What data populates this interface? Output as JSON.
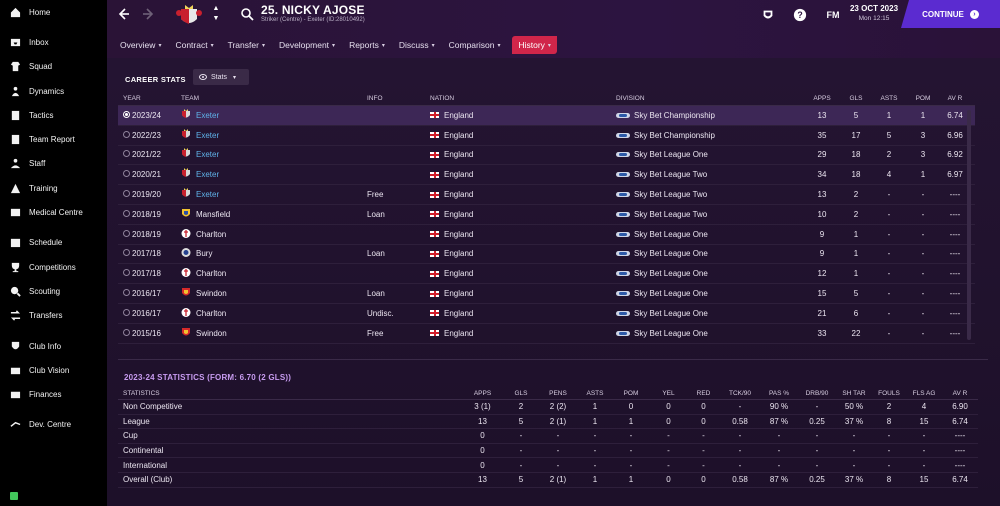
{
  "sidebar": {
    "items": [
      {
        "label": "Home",
        "icon": "home-icon"
      },
      {
        "label": "Inbox",
        "icon": "inbox-icon"
      },
      {
        "label": "Squad",
        "icon": "squad-icon"
      },
      {
        "label": "Dynamics",
        "icon": "dynamics-icon"
      },
      {
        "label": "Tactics",
        "icon": "tactics-icon"
      },
      {
        "label": "Team Report",
        "icon": "report-icon"
      },
      {
        "label": "Staff",
        "icon": "staff-icon"
      },
      {
        "label": "Training",
        "icon": "training-icon"
      },
      {
        "label": "Medical Centre",
        "icon": "medical-icon"
      },
      {
        "label": "Schedule",
        "icon": "calendar-icon"
      },
      {
        "label": "Competitions",
        "icon": "trophy-icon"
      },
      {
        "label": "Scouting",
        "icon": "scouting-icon"
      },
      {
        "label": "Transfers",
        "icon": "transfers-icon"
      },
      {
        "label": "Club Info",
        "icon": "shield-icon"
      },
      {
        "label": "Club Vision",
        "icon": "vision-icon"
      },
      {
        "label": "Finances",
        "icon": "finances-icon"
      },
      {
        "label": "Dev. Centre",
        "icon": "dev-centre-icon"
      }
    ]
  },
  "header": {
    "player_name": "25. NICKY AJOSE",
    "player_sub": "Striker (Centre) - Exeter (ID:28010492)",
    "fm_label": "FM",
    "date": "23 OCT 2023",
    "time": "Mon 12:15",
    "continue_label": "CONTINUE"
  },
  "tabs": [
    {
      "label": "Overview",
      "active": false
    },
    {
      "label": "Contract",
      "active": false
    },
    {
      "label": "Transfer",
      "active": false
    },
    {
      "label": "Development",
      "active": false
    },
    {
      "label": "Reports",
      "active": false
    },
    {
      "label": "Discuss",
      "active": false
    },
    {
      "label": "Comparison",
      "active": false
    },
    {
      "label": "History",
      "active": true
    }
  ],
  "career": {
    "title": "CAREER STATS",
    "view_dropdown": "Stats",
    "headers": {
      "year": "YEAR",
      "team": "TEAM",
      "info": "INFO",
      "nation": "NATION",
      "division": "DIVISION",
      "apps": "APPS",
      "gls": "GLS",
      "asts": "ASTS",
      "pom": "POM",
      "avr": "AV R"
    },
    "rows": [
      {
        "year": "2023/24",
        "team": "Exeter",
        "link": true,
        "info": "",
        "nation": "England",
        "division": "Sky Bet Championship",
        "apps": "13",
        "gls": "5",
        "asts": "1",
        "pom": "1",
        "avr": "6.74",
        "selected": true,
        "badge": "exeter"
      },
      {
        "year": "2022/23",
        "team": "Exeter",
        "link": true,
        "info": "",
        "nation": "England",
        "division": "Sky Bet Championship",
        "apps": "35",
        "gls": "17",
        "asts": "5",
        "pom": "3",
        "avr": "6.96",
        "badge": "exeter"
      },
      {
        "year": "2021/22",
        "team": "Exeter",
        "link": true,
        "info": "",
        "nation": "England",
        "division": "Sky Bet League One",
        "apps": "29",
        "gls": "18",
        "asts": "2",
        "pom": "3",
        "avr": "6.92",
        "badge": "exeter"
      },
      {
        "year": "2020/21",
        "team": "Exeter",
        "link": true,
        "info": "",
        "nation": "England",
        "division": "Sky Bet League Two",
        "apps": "34",
        "gls": "18",
        "asts": "4",
        "pom": "1",
        "avr": "6.97",
        "badge": "exeter"
      },
      {
        "year": "2019/20",
        "team": "Exeter",
        "link": true,
        "info": "Free",
        "nation": "England",
        "division": "Sky Bet League Two",
        "apps": "13",
        "gls": "2",
        "asts": "-",
        "pom": "-",
        "avr": "----",
        "badge": "exeter"
      },
      {
        "year": "2018/19",
        "team": "Mansfield",
        "link": false,
        "info": "Loan",
        "nation": "England",
        "division": "Sky Bet League Two",
        "apps": "10",
        "gls": "2",
        "asts": "-",
        "pom": "-",
        "avr": "----",
        "badge": "mansfield"
      },
      {
        "year": "2018/19",
        "team": "Charlton",
        "link": false,
        "info": "",
        "nation": "England",
        "division": "Sky Bet League One",
        "apps": "9",
        "gls": "1",
        "asts": "-",
        "pom": "-",
        "avr": "----",
        "badge": "charlton"
      },
      {
        "year": "2017/18",
        "team": "Bury",
        "link": false,
        "info": "Loan",
        "nation": "England",
        "division": "Sky Bet League One",
        "apps": "9",
        "gls": "1",
        "asts": "-",
        "pom": "-",
        "avr": "----",
        "badge": "bury"
      },
      {
        "year": "2017/18",
        "team": "Charlton",
        "link": false,
        "info": "",
        "nation": "England",
        "division": "Sky Bet League One",
        "apps": "12",
        "gls": "1",
        "asts": "-",
        "pom": "-",
        "avr": "----",
        "badge": "charlton"
      },
      {
        "year": "2016/17",
        "team": "Swindon",
        "link": false,
        "info": "Loan",
        "nation": "England",
        "division": "Sky Bet League One",
        "apps": "15",
        "gls": "5",
        "asts": "-",
        "pom": "-",
        "avr": "----",
        "badge": "swindon"
      },
      {
        "year": "2016/17",
        "team": "Charlton",
        "link": false,
        "info": "Undisc.",
        "nation": "England",
        "division": "Sky Bet League One",
        "apps": "21",
        "gls": "6",
        "asts": "-",
        "pom": "-",
        "avr": "----",
        "badge": "charlton"
      },
      {
        "year": "2015/16",
        "team": "Swindon",
        "link": false,
        "info": "Free",
        "nation": "England",
        "division": "Sky Bet League One",
        "apps": "33",
        "gls": "22",
        "asts": "-",
        "pom": "-",
        "avr": "----",
        "badge": "swindon"
      }
    ]
  },
  "season": {
    "title": "2023-24 STATISTICS (FORM: 6.70 (2 GLS))",
    "headers": [
      "STATISTICS",
      "APPS",
      "GLS",
      "PENS",
      "ASTS",
      "POM",
      "YEL",
      "RED",
      "TCK/90",
      "PAS %",
      "DRB/90",
      "SH TAR",
      "FOULS",
      "FLS AG",
      "AV R"
    ],
    "rows": [
      [
        "Non Competitive",
        "3 (1)",
        "2",
        "2 (2)",
        "1",
        "0",
        "0",
        "0",
        "-",
        "90 %",
        "-",
        "50 %",
        "2",
        "4",
        "6.90"
      ],
      [
        "League",
        "13",
        "5",
        "2 (1)",
        "1",
        "1",
        "0",
        "0",
        "0.58",
        "87 %",
        "0.25",
        "37 %",
        "8",
        "15",
        "6.74"
      ],
      [
        "Cup",
        "0",
        "-",
        "-",
        "-",
        "-",
        "-",
        "-",
        "-",
        "-",
        "-",
        "-",
        "-",
        "-",
        "----"
      ],
      [
        "Continental",
        "0",
        "-",
        "-",
        "-",
        "-",
        "-",
        "-",
        "-",
        "-",
        "-",
        "-",
        "-",
        "-",
        "----"
      ],
      [
        "International",
        "0",
        "-",
        "-",
        "-",
        "-",
        "-",
        "-",
        "-",
        "-",
        "-",
        "-",
        "-",
        "-",
        "----"
      ],
      [
        "Overall (Club)",
        "13",
        "5",
        "2 (1)",
        "1",
        "1",
        "0",
        "0",
        "0.58",
        "87 %",
        "0.25",
        "37 %",
        "8",
        "15",
        "6.74"
      ]
    ]
  },
  "colors": {
    "accent_tab": "#d0264a",
    "continue_button": "#5b2bd0",
    "team_link": "#5fb3ea",
    "season_title": "#c79bf0"
  }
}
